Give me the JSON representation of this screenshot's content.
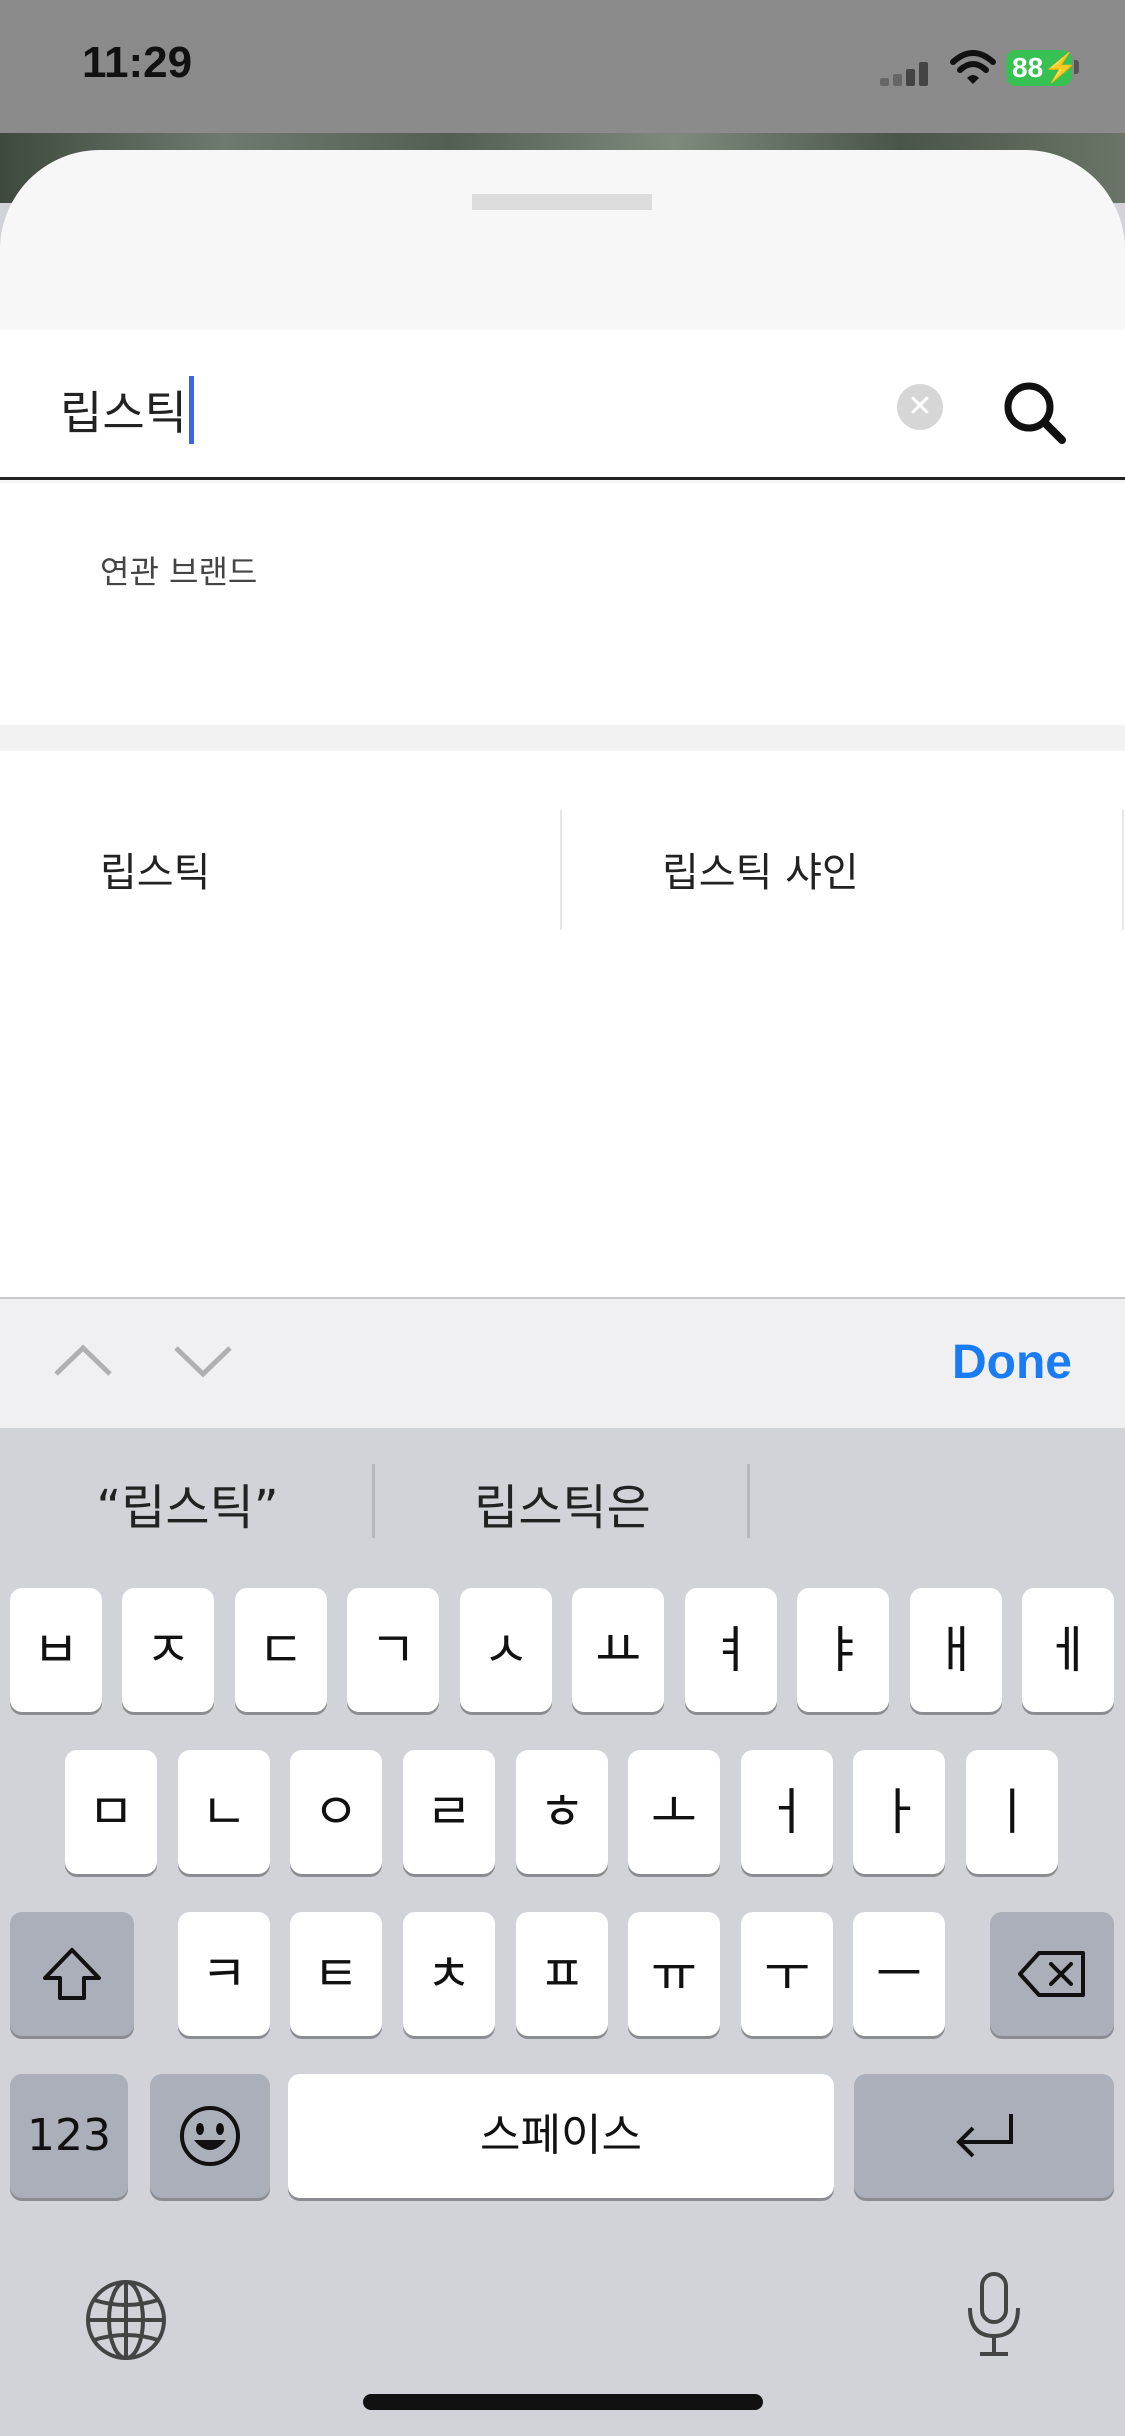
{
  "status": {
    "time": "11:29",
    "battery": "88"
  },
  "search": {
    "query": "립스틱",
    "clear_icon": "clear-icon",
    "search_icon": "search-icon"
  },
  "related": {
    "label": "연관 브랜드"
  },
  "results": [
    "립스틱",
    "립스틱 샤인"
  ],
  "toolbar": {
    "done": "Done"
  },
  "keyboard": {
    "predictions": [
      "“립스틱”",
      "립스틱은"
    ],
    "row1": [
      "ㅂ",
      "ㅈ",
      "ㄷ",
      "ㄱ",
      "ㅅ",
      "ㅛ",
      "ㅕ",
      "ㅑ",
      "ㅐ",
      "ㅔ"
    ],
    "row2": [
      "ㅁ",
      "ㄴ",
      "ㅇ",
      "ㄹ",
      "ㅎ",
      "ㅗ",
      "ㅓ",
      "ㅏ",
      "ㅣ"
    ],
    "row3": [
      "ㅋ",
      "ㅌ",
      "ㅊ",
      "ㅍ",
      "ㅠ",
      "ㅜ",
      "ㅡ"
    ],
    "numbers_key": "123",
    "space_key": "스페이스"
  }
}
